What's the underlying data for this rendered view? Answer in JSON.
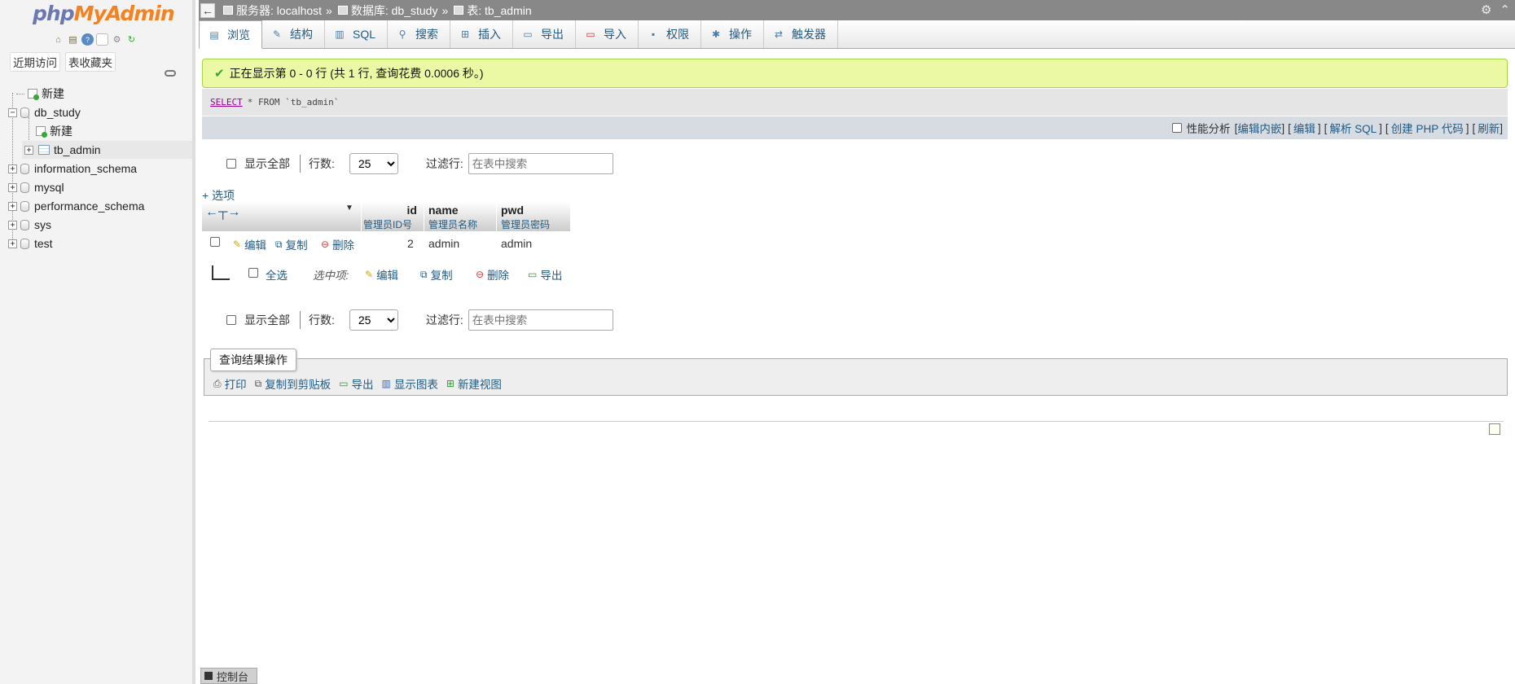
{
  "app": {
    "logo_php": "php",
    "logo_rest": "MyAdmin"
  },
  "sidebar": {
    "tabs": [
      "近期访问",
      "表收藏夹"
    ],
    "tree": {
      "new_top": "新建",
      "db_study": "db_study",
      "db_new": "新建",
      "tb_admin": "tb_admin",
      "information_schema": "information_schema",
      "mysql": "mysql",
      "performance_schema": "performance_schema",
      "sys": "sys",
      "test": "test"
    }
  },
  "breadcrumb": {
    "server": "服务器: localhost",
    "sep": "»",
    "database": "数据库: db_study",
    "table": "表: tb_admin"
  },
  "tabs": [
    "浏览",
    "结构",
    "SQL",
    "搜索",
    "插入",
    "导出",
    "导入",
    "权限",
    "操作",
    "触发器"
  ],
  "message": {
    "success": "正在显示第 0 - 0 行 (共 1 行, 查询花费 0.0006 秒。)"
  },
  "sql": {
    "keyword": "SELECT",
    "rest": "* FROM `tb_admin`"
  },
  "sql_tools": {
    "profiling": "性能分析",
    "inline_edit": "编辑内嵌",
    "edit": "编辑",
    "explain": "解析 SQL",
    "create_php": "创建 PHP 代码",
    "refresh": "刷新"
  },
  "nav": {
    "show_all": "显示全部",
    "rows_label": "行数:",
    "rows_value": "25",
    "filter_label": "过滤行:",
    "filter_placeholder": "在表中搜索"
  },
  "options_link": "+ 选项",
  "table": {
    "columns": [
      {
        "name": "id",
        "comment": "管理员ID号"
      },
      {
        "name": "name",
        "comment": "管理员名称"
      },
      {
        "name": "pwd",
        "comment": "管理员密码"
      }
    ],
    "row_actions": {
      "edit": "编辑",
      "copy": "复制",
      "delete": "删除"
    },
    "rows": [
      {
        "id": "2",
        "name": "admin",
        "pwd": "admin"
      }
    ]
  },
  "bulk": {
    "select_all": "全选",
    "with_selected": "选中项:",
    "edit": "编辑",
    "copy": "复制",
    "delete": "删除",
    "export": "导出"
  },
  "query_results": {
    "legend": "查询结果操作",
    "print": "打印",
    "copy_clipboard": "复制到剪贴板",
    "export": "导出",
    "show_chart": "显示图表",
    "create_view": "新建视图"
  },
  "console": "控制台"
}
